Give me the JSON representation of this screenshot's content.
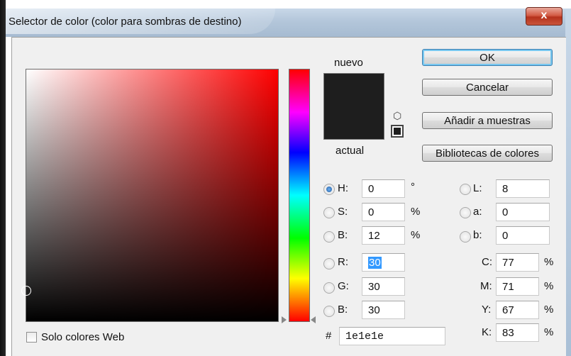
{
  "window": {
    "title": "Selector de color (color para sombras de destino)",
    "close_label": "x"
  },
  "preview": {
    "new_label": "nuevo",
    "current_label": "actual",
    "color": "#1e1e1e"
  },
  "buttons": {
    "ok": "OK",
    "cancel": "Cancelar",
    "add_swatches": "Añadir a muestras",
    "libraries": "Bibliotecas de colores"
  },
  "hsb": {
    "h_label": "H:",
    "h": "0",
    "h_unit": "°",
    "s_label": "S:",
    "s": "0",
    "s_unit": "%",
    "b_label": "B:",
    "b": "12",
    "b_unit": "%",
    "selected": "H"
  },
  "rgb": {
    "r_label": "R:",
    "r": "30",
    "g_label": "G:",
    "g": "30",
    "b_label": "B:",
    "b": "30"
  },
  "lab": {
    "l_label": "L:",
    "l": "8",
    "a_label": "a:",
    "a": "0",
    "b_label": "b:",
    "b": "0"
  },
  "cmyk": {
    "c_label": "C:",
    "c": "77",
    "m_label": "M:",
    "m": "71",
    "y_label": "Y:",
    "y": "67",
    "k_label": "K:",
    "k": "83",
    "unit": "%"
  },
  "hex": {
    "label": "#",
    "value": "1e1e1e"
  },
  "web_only": {
    "label": "Solo colores Web",
    "checked": false
  }
}
